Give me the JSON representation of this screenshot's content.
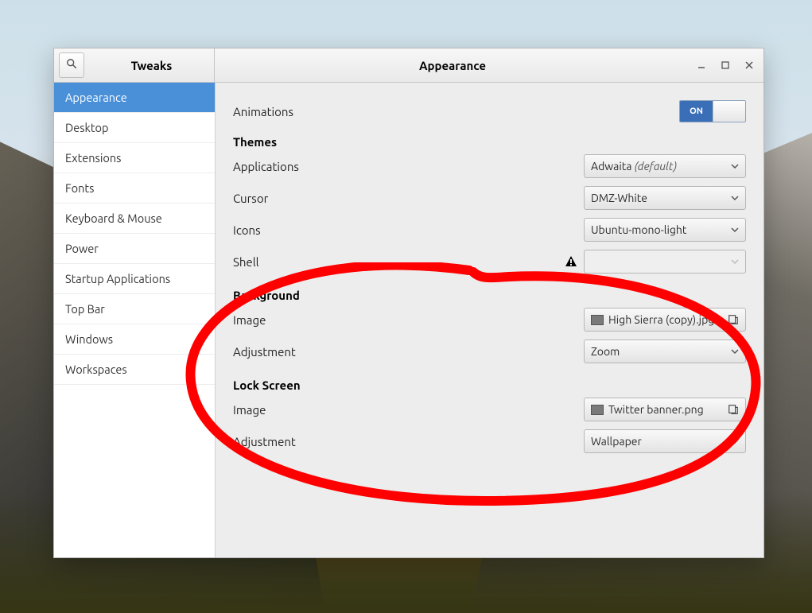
{
  "header": {
    "left_title": "Tweaks",
    "center_title": "Appearance"
  },
  "sidebar": {
    "items": [
      {
        "label": "Appearance",
        "selected": true
      },
      {
        "label": "Desktop"
      },
      {
        "label": "Extensions"
      },
      {
        "label": "Fonts"
      },
      {
        "label": "Keyboard & Mouse"
      },
      {
        "label": "Power"
      },
      {
        "label": "Startup Applications"
      },
      {
        "label": "Top Bar"
      },
      {
        "label": "Windows"
      },
      {
        "label": "Workspaces"
      }
    ]
  },
  "content": {
    "animations": {
      "label": "Animations",
      "toggle": "ON"
    },
    "themes": {
      "header": "Themes",
      "applications": {
        "label": "Applications",
        "value": "Adwaita",
        "suffix": "(default)"
      },
      "cursor": {
        "label": "Cursor",
        "value": "DMZ-White"
      },
      "icons": {
        "label": "Icons",
        "value": "Ubuntu-mono-light"
      },
      "shell": {
        "label": "Shell",
        "value": "",
        "disabled": true,
        "warn": true
      }
    },
    "background": {
      "header": "Background",
      "image": {
        "label": "Image",
        "file": "High Sierra (copy).jpg"
      },
      "adjustment": {
        "label": "Adjustment",
        "value": "Zoom"
      }
    },
    "lockscreen": {
      "header": "Lock Screen",
      "image": {
        "label": "Image",
        "file": "Twitter banner.png"
      },
      "adjustment": {
        "label": "Adjustment",
        "value": "Wallpaper"
      }
    }
  }
}
